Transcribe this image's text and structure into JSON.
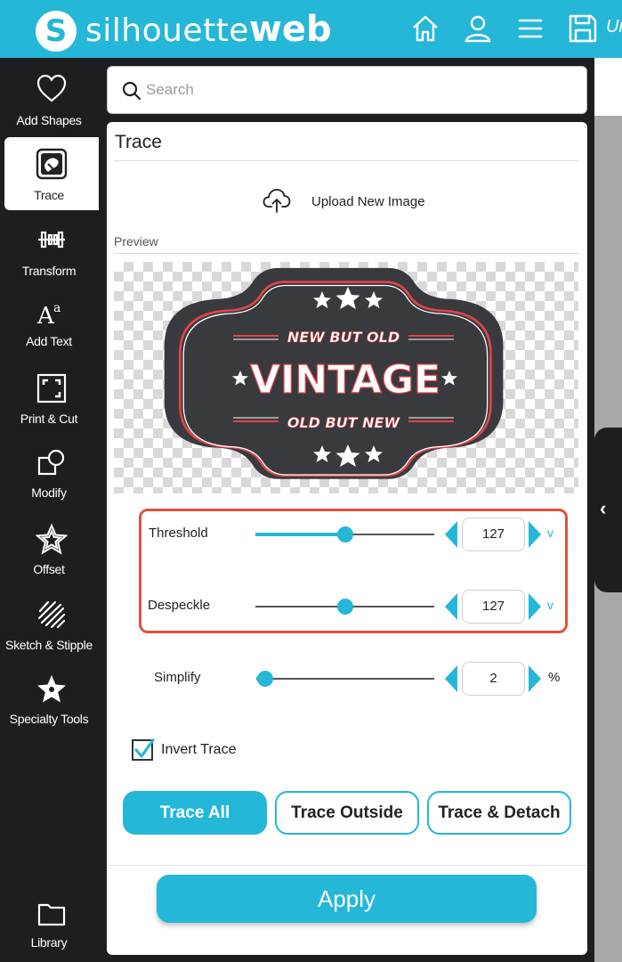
{
  "app": {
    "logo_mark": "S",
    "brand_light": "silhouette",
    "brand_bold": "web",
    "cut_off_text": "Ur"
  },
  "header_icons": [
    "home-icon",
    "user-icon",
    "menu-icon",
    "save-icon"
  ],
  "colors": {
    "accent": "#25b7d8",
    "sidebar_bg": "#1c1e20",
    "highlight": "#e0513f"
  },
  "sidebar": {
    "items": [
      {
        "label": "Add Shapes",
        "icon": "heart-icon",
        "active": false
      },
      {
        "label": "Trace",
        "icon": "trace-icon",
        "active": true
      },
      {
        "label": "Transform",
        "icon": "transform-icon",
        "active": false
      },
      {
        "label": "Add Text",
        "icon": "text-icon",
        "active": false
      },
      {
        "label": "Print & Cut",
        "icon": "print-cut-icon",
        "active": false
      },
      {
        "label": "Modify",
        "icon": "modify-icon",
        "active": false
      },
      {
        "label": "Offset",
        "icon": "star-outline-icon",
        "active": false
      },
      {
        "label": "Sketch & Stipple",
        "icon": "sketch-icon",
        "active": false
      },
      {
        "label": "Specialty Tools",
        "icon": "star-filled-icon",
        "active": false
      },
      {
        "label": "Library",
        "icon": "folder-icon",
        "active": false
      }
    ]
  },
  "search": {
    "placeholder": "Search"
  },
  "panel": {
    "title": "Trace",
    "upload_label": "Upload New Image",
    "preview_label": "Preview",
    "preview_image": {
      "line_top": "NEW BUT OLD",
      "line_main": "VINTAGE",
      "line_bottom": "OLD BUT NEW"
    },
    "sliders": [
      {
        "label": "Threshold",
        "value": "127",
        "fraction": 0.5,
        "unit": "v"
      },
      {
        "label": "Despeckle",
        "value": "127",
        "fraction": 0.5,
        "unit": "v"
      },
      {
        "label": "Simplify",
        "value": "2",
        "fraction": 0.05,
        "unit": "%"
      }
    ],
    "invert_trace": {
      "label": "Invert Trace",
      "checked": true
    },
    "buttons": {
      "trace_all": "Trace All",
      "trace_outside": "Trace Outside",
      "trace_detach": "Trace & Detach"
    },
    "apply_label": "Apply"
  }
}
